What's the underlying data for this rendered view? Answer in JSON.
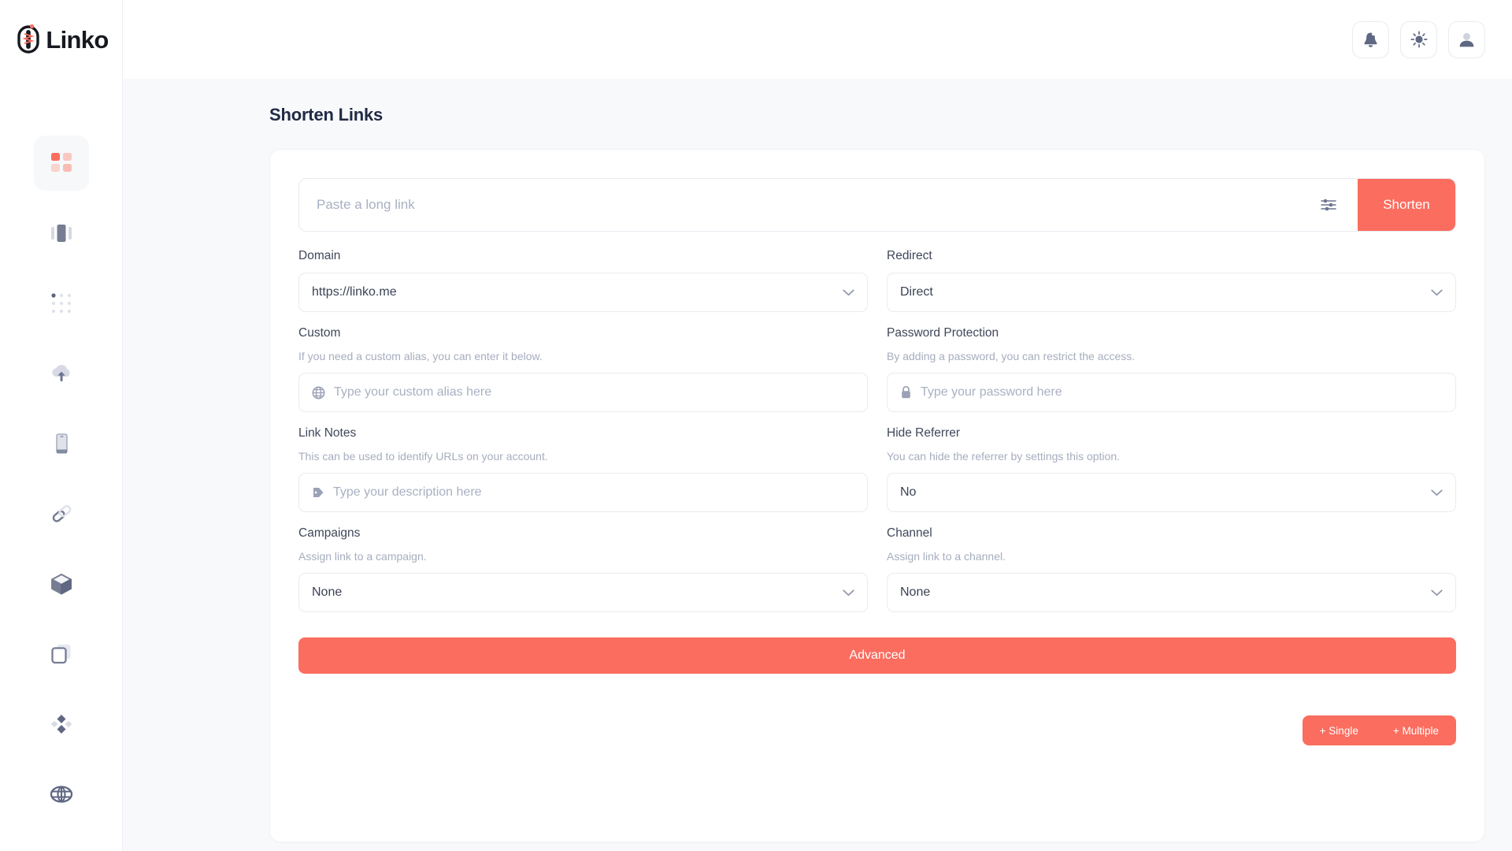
{
  "brand": {
    "name": "Linko",
    "accent": "#fb6d5f",
    "logo_icon": "link-chain-icon"
  },
  "sidebar": {
    "items": [
      {
        "name": "sidebar-item-dashboard",
        "icon": "grid-squares-icon",
        "active": true
      },
      {
        "name": "sidebar-item-statistics",
        "icon": "bar-columns-icon",
        "active": false
      },
      {
        "name": "sidebar-item-apps",
        "icon": "dot-grid-icon",
        "active": false
      },
      {
        "name": "sidebar-item-upload",
        "icon": "cloud-upload-icon",
        "active": false
      },
      {
        "name": "sidebar-item-devices",
        "icon": "mobile-device-icon",
        "active": false
      },
      {
        "name": "sidebar-item-links",
        "icon": "link-icon",
        "active": false
      },
      {
        "name": "sidebar-item-packages",
        "icon": "cube-icon",
        "active": false
      },
      {
        "name": "sidebar-item-pages",
        "icon": "copy-layers-icon",
        "active": false
      },
      {
        "name": "sidebar-item-integrations",
        "icon": "diamonds-icon",
        "active": false
      },
      {
        "name": "sidebar-item-domains",
        "icon": "globe-icon",
        "active": false
      }
    ]
  },
  "topbar": {
    "buttons": [
      {
        "name": "notifications-button",
        "icon": "bell-icon"
      },
      {
        "name": "theme-toggle-button",
        "icon": "sun-icon"
      },
      {
        "name": "profile-button",
        "icon": "user-icon"
      }
    ]
  },
  "page": {
    "title": "Shorten Links"
  },
  "link_row": {
    "input_placeholder": "Paste a long link",
    "input_value": "",
    "filter_icon": "sliders-icon",
    "shorten_label": "Shorten"
  },
  "fields": {
    "domain": {
      "label": "Domain",
      "value": "https://linko.me",
      "chevron_icon": "chevron-down-icon"
    },
    "redirect": {
      "label": "Redirect",
      "value": "Direct",
      "chevron_icon": "chevron-down-icon"
    },
    "custom": {
      "label": "Custom",
      "hint": "If you need a custom alias, you can enter it below.",
      "placeholder": "Type your custom alias here",
      "value": "",
      "lead_icon": "globe-icon"
    },
    "password": {
      "label": "Password Protection",
      "hint": "By adding a password, you can restrict the access.",
      "placeholder": "Type your password here",
      "value": "",
      "lead_icon": "lock-icon"
    },
    "notes": {
      "label": "Link Notes",
      "hint": "This can be used to identify URLs on your account.",
      "placeholder": "Type your description here",
      "value": "",
      "lead_icon": "tag-icon"
    },
    "hide_referrer": {
      "label": "Hide Referrer",
      "hint": "You can hide the referrer by settings this option.",
      "value": "No",
      "chevron_icon": "chevron-down-icon"
    },
    "campaigns": {
      "label": "Campaigns",
      "hint": "Assign link to a campaign.",
      "value": "None",
      "chevron_icon": "chevron-down-icon"
    },
    "channel": {
      "label": "Channel",
      "hint": "Assign link to a channel.",
      "value": "None",
      "chevron_icon": "chevron-down-icon"
    }
  },
  "advanced": {
    "label": "Advanced"
  },
  "bottom_actions": {
    "single_label": "+ Single",
    "multiple_label": "+ Multiple"
  }
}
